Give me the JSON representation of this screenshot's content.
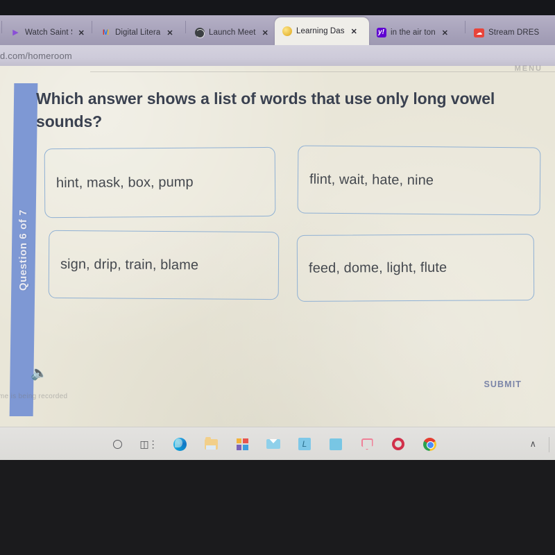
{
  "browser": {
    "tabs": [
      {
        "title": "Watch Saint S",
        "favicon": "twitch-play-icon",
        "active": false,
        "close": "✕"
      },
      {
        "title": "Digital Litera",
        "favicon": "gmail-icon",
        "active": false,
        "close": "✕"
      },
      {
        "title": "Launch Meet",
        "favicon": "globe-icon",
        "active": false,
        "close": "✕"
      },
      {
        "title": "Learning Das",
        "favicon": "learning-dashboard-icon",
        "active": true,
        "close": "✕"
      },
      {
        "title": "in the air ton",
        "favicon": "yahoo-icon",
        "active": false,
        "close": "✕"
      },
      {
        "title": "Stream DRES",
        "favicon": "soundcloud-icon",
        "active": false,
        "close": ""
      }
    ],
    "address": "d.com/homeroom"
  },
  "quiz": {
    "menu_label": "MENU",
    "progress_label": "Question 6 of 7",
    "question": "Which answer shows a list of words that use only long vowel sounds?",
    "choices": [
      "hint, mask, box, pump",
      "flint, wait, hate, nine",
      "sign, drip, train, blame",
      "feed, dome, light, flute"
    ],
    "speaker_icon": "speaker-icon",
    "recording_note": "me is being recorded",
    "submit_label": "SUBMIT",
    "accent_color": "#7e98d4",
    "choice_border_color": "#8fb0d4",
    "page_background": "#e9e6d8"
  },
  "taskbar": {
    "items": [
      {
        "name": "search-icon"
      },
      {
        "name": "task-view-icon"
      },
      {
        "name": "edge-icon"
      },
      {
        "name": "file-explorer-icon"
      },
      {
        "name": "microsoft-store-icon"
      },
      {
        "name": "mail-icon"
      },
      {
        "name": "lexia-app-icon",
        "label": "L"
      },
      {
        "name": "blue-app-icon"
      },
      {
        "name": "shield-app-icon"
      },
      {
        "name": "opera-icon"
      },
      {
        "name": "chrome-icon"
      }
    ],
    "chevron": "∧"
  },
  "cursor": {
    "name": "mouse-pointer-busy"
  }
}
